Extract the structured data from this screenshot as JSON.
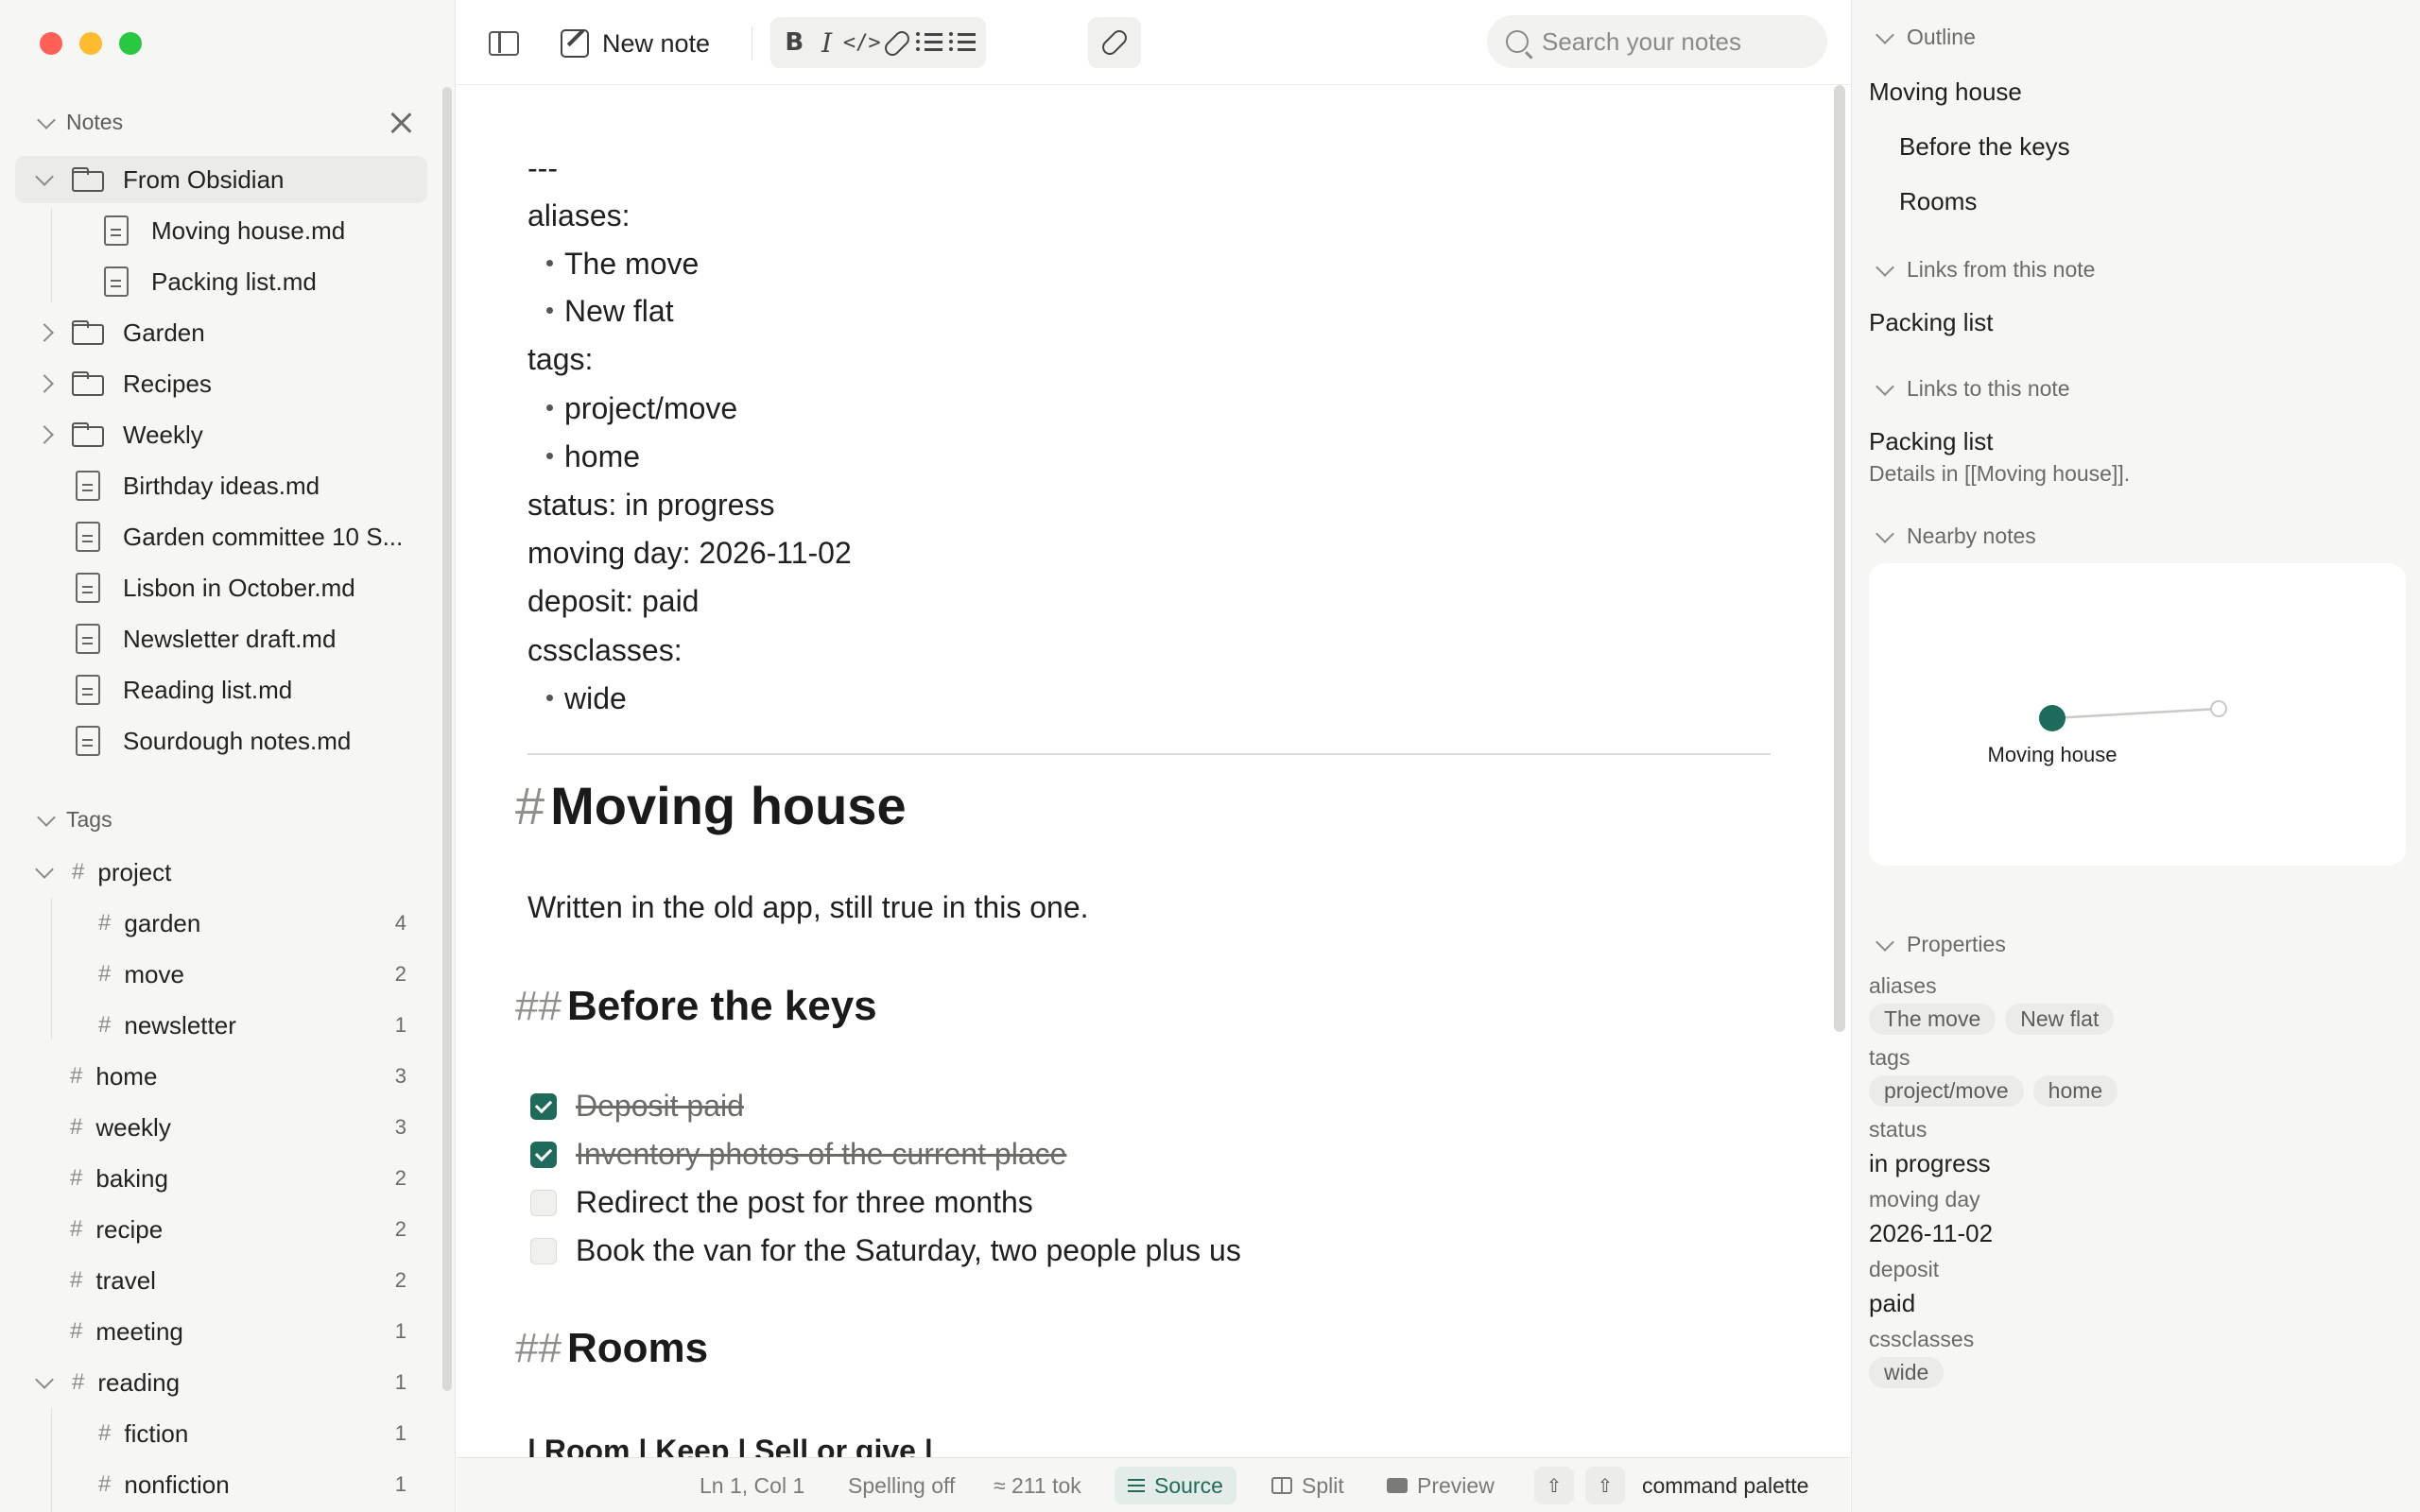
{
  "toolbar": {
    "new_note": "New note",
    "fmt": {
      "bold": "B",
      "italic": "I",
      "code": "</>"
    },
    "search_placeholder": "Search your notes"
  },
  "sidebar": {
    "notes_header": "Notes",
    "folder_open": "From Obsidian",
    "folder_children": [
      "Moving house.md",
      "Packing list.md"
    ],
    "folders": [
      "Garden",
      "Recipes",
      "Weekly"
    ],
    "files": [
      "Birthday ideas.md",
      "Garden committee 10 S...",
      "Lisbon in October.md",
      "Newsletter draft.md",
      "Reading list.md",
      "Sourdough notes.md"
    ],
    "tags_header": "Tags",
    "tags": [
      {
        "name": "project",
        "count": ""
      },
      {
        "name": "garden",
        "count": "4"
      },
      {
        "name": "move",
        "count": "2"
      },
      {
        "name": "newsletter",
        "count": "1"
      },
      {
        "name": "home",
        "count": "3"
      },
      {
        "name": "weekly",
        "count": "3"
      },
      {
        "name": "baking",
        "count": "2"
      },
      {
        "name": "recipe",
        "count": "2"
      },
      {
        "name": "travel",
        "count": "2"
      },
      {
        "name": "meeting",
        "count": "1"
      },
      {
        "name": "reading",
        "count": "1"
      },
      {
        "name": "fiction",
        "count": "1"
      },
      {
        "name": "nonfiction",
        "count": "1"
      }
    ]
  },
  "editor": {
    "frontmatter": {
      "dashes": "---",
      "aliases_key": "aliases:",
      "aliases": [
        "The move",
        "New flat"
      ],
      "tags_key": "tags:",
      "tags": [
        "project/move",
        "home"
      ],
      "status": "status: in progress",
      "moving_day": "moving day: 2026-11-02",
      "deposit": "deposit: paid",
      "cssclasses_key": "cssclasses:",
      "cssclasses": [
        "wide"
      ]
    },
    "h1_mark": "#",
    "h1": "Moving house",
    "intro": "Written in the old app, still true in this one.",
    "h2_mark": "##",
    "h2_before": "Before the keys",
    "tasks": [
      {
        "text": "Deposit paid",
        "done": true
      },
      {
        "text": "Inventory photos of the current place",
        "done": true
      },
      {
        "text": "Redirect the post for three months",
        "done": false
      },
      {
        "text": "Book the van for the Saturday, two people plus us",
        "done": false
      }
    ],
    "h2_rooms": "Rooms",
    "table_header": "| Room | Keep | Sell or give |"
  },
  "statusbar": {
    "position": "Ln 1, Col 1",
    "spelling": "Spelling off",
    "tokens": "≈ 211 tok",
    "source": "Source",
    "split": "Split",
    "preview": "Preview",
    "up1": "⇧",
    "up2": "⇧",
    "command": "command palette"
  },
  "right": {
    "outline_header": "Outline",
    "outline": [
      "Moving house",
      "Before the keys",
      "Rooms"
    ],
    "links_from_header": "Links from this note",
    "links_from": [
      "Packing list"
    ],
    "links_to_header": "Links to this note",
    "links_to_title": "Packing list",
    "links_to_context": "Details in [[Moving house]].",
    "nearby_header": "Nearby notes",
    "graph_node_label": "Moving house",
    "properties_header": "Properties",
    "props": {
      "aliases_key": "aliases",
      "aliases": [
        "The move",
        "New flat"
      ],
      "tags_key": "tags",
      "tags": [
        "project/move",
        "home"
      ],
      "status_key": "status",
      "status": "in progress",
      "moving_day_key": "moving day",
      "moving_day": "2026-11-02",
      "deposit_key": "deposit",
      "deposit": "paid",
      "cssclasses_key": "cssclasses",
      "cssclasses": [
        "wide"
      ]
    }
  },
  "colors": {
    "accent": "#1f6b5b",
    "sidebar_bg": "#f6f6f4",
    "selected_row": "#ebebe8"
  }
}
